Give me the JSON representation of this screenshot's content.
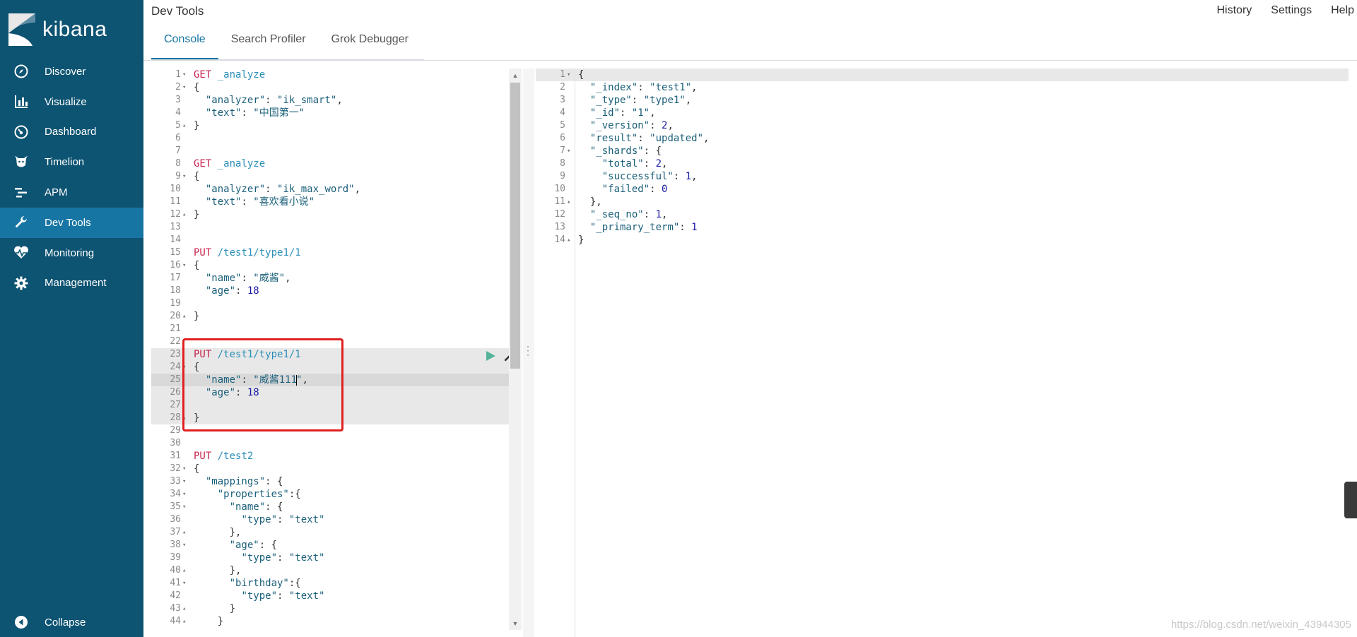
{
  "sidebar": {
    "logo_text": "kibana",
    "items": [
      {
        "label": "Discover",
        "icon": "compass-icon"
      },
      {
        "label": "Visualize",
        "icon": "bar-chart-icon"
      },
      {
        "label": "Dashboard",
        "icon": "dashboard-icon"
      },
      {
        "label": "Timelion",
        "icon": "timelion-icon"
      },
      {
        "label": "APM",
        "icon": "apm-icon"
      },
      {
        "label": "Dev Tools",
        "icon": "wrench-icon",
        "active": true
      },
      {
        "label": "Monitoring",
        "icon": "heartbeat-icon"
      },
      {
        "label": "Management",
        "icon": "gear-icon"
      }
    ],
    "collapse_label": "Collapse"
  },
  "header": {
    "title": "Dev Tools",
    "links": [
      "History",
      "Settings",
      "Help"
    ],
    "tabs": [
      "Console",
      "Search Profiler",
      "Grok Debugger"
    ],
    "active_tab": "Console"
  },
  "request_editor": {
    "lines": [
      [
        "1",
        "▾",
        "<span class='m'>GET</span> <span class='u'>_analyze</span>"
      ],
      [
        "2",
        "▾",
        "{"
      ],
      [
        "3",
        "",
        "  <span class='k'>\"analyzer\"</span>: <span class='s'>\"ik_smart\"</span>,"
      ],
      [
        "4",
        "",
        "  <span class='k'>\"text\"</span>: <span class='s'>\"中国第一\"</span>"
      ],
      [
        "5",
        "▴",
        "}"
      ],
      [
        "6",
        "",
        ""
      ],
      [
        "7",
        "",
        ""
      ],
      [
        "8",
        "",
        "<span class='m'>GET</span> <span class='u'>_analyze</span>"
      ],
      [
        "9",
        "▾",
        "{"
      ],
      [
        "10",
        "",
        "  <span class='k'>\"analyzer\"</span>: <span class='s'>\"ik_max_word\"</span>,"
      ],
      [
        "11",
        "",
        "  <span class='k'>\"text\"</span>: <span class='s'>\"喜欢看小说\"</span>"
      ],
      [
        "12",
        "▴",
        "}"
      ],
      [
        "13",
        "",
        ""
      ],
      [
        "14",
        "",
        ""
      ],
      [
        "15",
        "",
        "<span class='m'>PUT</span> <span class='u'>/test1/type1/1</span>"
      ],
      [
        "16",
        "▾",
        "{"
      ],
      [
        "17",
        "",
        "  <span class='k'>\"name\"</span>: <span class='s'>\"威酱\"</span>,"
      ],
      [
        "18",
        "",
        "  <span class='k'>\"age\"</span>: <span class='n'>18</span>"
      ],
      [
        "19",
        "",
        ""
      ],
      [
        "20",
        "▴",
        "}"
      ],
      [
        "21",
        "",
        ""
      ],
      [
        "22",
        "",
        ""
      ],
      [
        "23",
        "",
        "<span class='m'>PUT</span> <span class='u'>/test1/type1/1</span>"
      ],
      [
        "24",
        "▾",
        "{"
      ],
      [
        "25",
        "",
        "  <span class='k'>\"name\"</span>: <span class='s'>\"威酱111<span class='cursor'></span>\"</span>,"
      ],
      [
        "26",
        "",
        "  <span class='k'>\"age\"</span>: <span class='n'>18</span>"
      ],
      [
        "27",
        "",
        ""
      ],
      [
        "28",
        "▴",
        "}"
      ],
      [
        "29",
        "",
        ""
      ],
      [
        "30",
        "",
        ""
      ],
      [
        "31",
        "",
        "<span class='m'>PUT</span> <span class='u'>/test2</span>"
      ],
      [
        "32",
        "▾",
        "{"
      ],
      [
        "33",
        "▾",
        "  <span class='k'>\"mappings\"</span>: {"
      ],
      [
        "34",
        "▾",
        "    <span class='k'>\"properties\"</span>:{"
      ],
      [
        "35",
        "▾",
        "      <span class='k'>\"name\"</span>: {"
      ],
      [
        "36",
        "",
        "        <span class='k'>\"type\"</span>: <span class='s'>\"text\"</span>"
      ],
      [
        "37",
        "▴",
        "      },"
      ],
      [
        "38",
        "▾",
        "      <span class='k'>\"age\"</span>: {"
      ],
      [
        "39",
        "",
        "        <span class='k'>\"type\"</span>: <span class='s'>\"text\"</span>"
      ],
      [
        "40",
        "▴",
        "      },"
      ],
      [
        "41",
        "▾",
        "      <span class='k'>\"birthday\"</span>:{"
      ],
      [
        "42",
        "",
        "        <span class='k'>\"type\"</span>: <span class='s'>\"text\"</span>"
      ],
      [
        "43",
        "▴",
        "      }"
      ],
      [
        "44",
        "▴",
        "    }"
      ]
    ]
  },
  "response_editor": {
    "lines": [
      [
        "1",
        "▾",
        "{"
      ],
      [
        "2",
        "",
        "  <span class='k'>\"_index\"</span>: <span class='s'>\"test1\"</span>,"
      ],
      [
        "3",
        "",
        "  <span class='k'>\"_type\"</span>: <span class='s'>\"type1\"</span>,"
      ],
      [
        "4",
        "",
        "  <span class='k'>\"_id\"</span>: <span class='s'>\"1\"</span>,"
      ],
      [
        "5",
        "",
        "  <span class='k'>\"_version\"</span>: <span class='n'>2</span>,"
      ],
      [
        "6",
        "",
        "  <span class='k'>\"result\"</span>: <span class='s'>\"updated\"</span>,"
      ],
      [
        "7",
        "▾",
        "  <span class='k'>\"_shards\"</span>: {"
      ],
      [
        "8",
        "",
        "    <span class='k'>\"total\"</span>: <span class='n'>2</span>,"
      ],
      [
        "9",
        "",
        "    <span class='k'>\"successful\"</span>: <span class='n'>1</span>,"
      ],
      [
        "10",
        "",
        "    <span class='k'>\"failed\"</span>: <span class='n'>0</span>"
      ],
      [
        "11",
        "▴",
        "  },"
      ],
      [
        "12",
        "",
        "  <span class='k'>\"_seq_no\"</span>: <span class='n'>1</span>,"
      ],
      [
        "13",
        "",
        "  <span class='k'>\"_primary_term\"</span>: <span class='n'>1</span>"
      ],
      [
        "14",
        "▴",
        "}"
      ]
    ]
  },
  "watermark": "https://blog.csdn.net/weixin_43944305",
  "colors": {
    "sidebar_bg": "#0d5372",
    "sidebar_active": "#1775a4",
    "method": "#c7254e",
    "url": "#2b8fb8",
    "run_button": "#54b399",
    "highlight_box": "#e02020"
  }
}
